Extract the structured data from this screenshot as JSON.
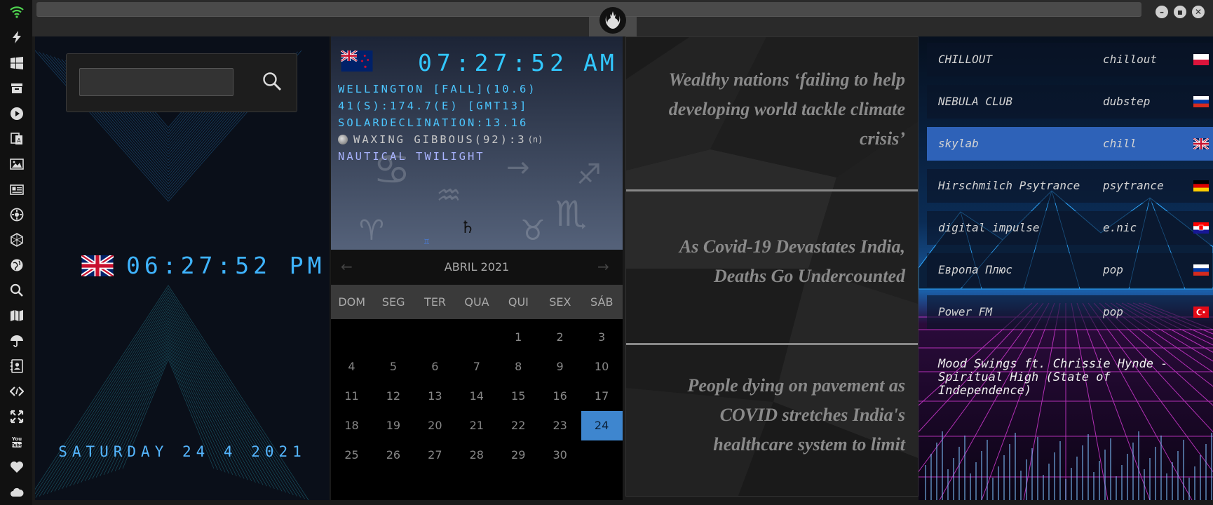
{
  "sidebar": {
    "icons": [
      "wifi-icon",
      "bolt-icon",
      "windows-icon",
      "archive-icon",
      "play-icon",
      "translate-icon",
      "image-icon",
      "news-icon",
      "settings-icon",
      "hexagon-icon",
      "globe-icon",
      "search-icon",
      "map-icon",
      "umbrella-icon",
      "contacts-icon",
      "code-icon",
      "expand-icon",
      "youtube-icon",
      "heart-icon",
      "cloud-icon"
    ]
  },
  "window": {
    "minimize": "–",
    "maximize": "▪",
    "close": "✕"
  },
  "search": {
    "placeholder": ""
  },
  "uk_clock": {
    "time": "06:27:52 PM",
    "date": "SATURDAY 24 4 2021"
  },
  "nz_clock": {
    "time": "07:27:52",
    "ampm": "AM",
    "line1": "WELLINGTON [FALL](10.6)",
    "line2": "41(S):174.7(E) [GMT13]",
    "line3": "SOLARDECLINATION:13.16",
    "line4": "WAXING GIBBOUS(92):3",
    "line4_suffix": "(n)",
    "line5": "NAUTICAL TWILIGHT",
    "planet_symbol": "♄",
    "small_symbol": "♊"
  },
  "calendar": {
    "month": "ABRIL 2021",
    "prev": "←",
    "next": "→",
    "days": [
      "DOM",
      "SEG",
      "TER",
      "QUA",
      "QUI",
      "SEX",
      "SÁB"
    ],
    "weeks": [
      [
        "",
        "",
        "",
        "",
        "1",
        "2",
        "3"
      ],
      [
        "4",
        "5",
        "6",
        "7",
        "8",
        "9",
        "10"
      ],
      [
        "11",
        "12",
        "13",
        "14",
        "15",
        "16",
        "17"
      ],
      [
        "18",
        "19",
        "20",
        "21",
        "22",
        "23",
        "24"
      ],
      [
        "25",
        "26",
        "27",
        "28",
        "29",
        "30",
        ""
      ]
    ],
    "today": "24"
  },
  "news": [
    "Wealthy nations ‘failing to help developing world tackle climate crisis’",
    "As Covid-19 Devastates India, Deaths Go Undercounted",
    "People dying on pavement as COVID stretches India's healthcare system to limit"
  ],
  "radio": {
    "stations": [
      {
        "name": "CHILLOUT",
        "genre": "chillout",
        "flag": "pl"
      },
      {
        "name": "NEBULA CLUB",
        "genre": "dubstep",
        "flag": "ru"
      },
      {
        "name": "skylab",
        "genre": "chill",
        "flag": "gb"
      },
      {
        "name": "Hirschmilch Psytrance",
        "genre": "psytrance",
        "flag": "de"
      },
      {
        "name": "digital impulse",
        "genre": "e.nic",
        "flag": "hr"
      },
      {
        "name": "Европа Плюс",
        "genre": "pop",
        "flag": "ru"
      },
      {
        "name": "Power FM",
        "genre": "pop",
        "flag": "tr"
      }
    ],
    "selected": "skylab",
    "now_playing": "Mood Swings ft. Chrissie Hynde - Spiritual High (State of Independence)"
  },
  "colors": {
    "accent": "#3e86cf",
    "lcd": "#33aaff",
    "nz_lcd": "#32c8ff",
    "lavender": "#a9b4ff"
  }
}
